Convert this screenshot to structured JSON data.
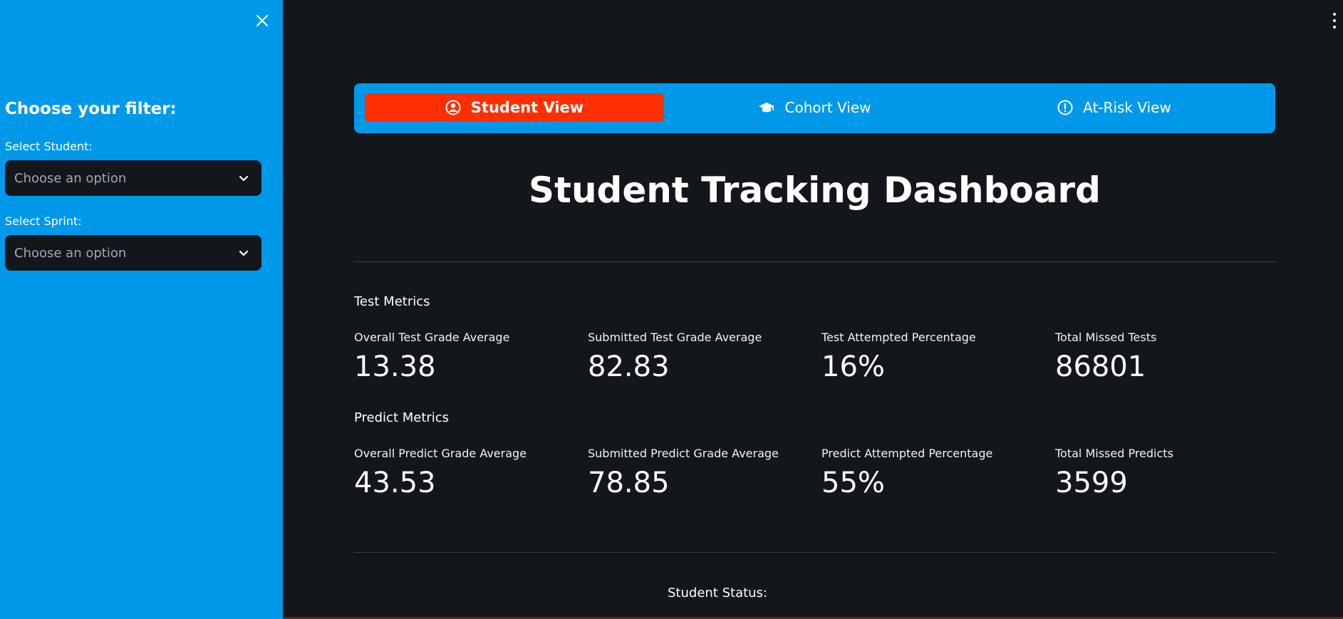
{
  "sidebar": {
    "title": "Choose your filter:",
    "student_label": "Select Student:",
    "student_placeholder": "Choose an option",
    "sprint_label": "Select Sprint:",
    "sprint_placeholder": "Choose an option"
  },
  "tabs": [
    {
      "label": "Student View",
      "icon": "user-circle-icon",
      "active": true
    },
    {
      "label": "Cohort View",
      "icon": "graduation-cap-icon",
      "active": false
    },
    {
      "label": "At-Risk View",
      "icon": "alert-circle-icon",
      "active": false
    }
  ],
  "main": {
    "title": "Student Tracking Dashboard",
    "test_section": "Test Metrics",
    "test_metrics": [
      {
        "label": "Overall Test Grade Average",
        "value": "13.38"
      },
      {
        "label": "Submitted Test Grade Average",
        "value": "82.83"
      },
      {
        "label": "Test Attempted Percentage",
        "value": "16%"
      },
      {
        "label": "Total Missed Tests",
        "value": "86801"
      }
    ],
    "predict_section": "Predict Metrics",
    "predict_metrics": [
      {
        "label": "Overall Predict Grade Average",
        "value": "43.53"
      },
      {
        "label": "Submitted Predict Grade Average",
        "value": "78.85"
      },
      {
        "label": "Predict Attempted Percentage",
        "value": "55%"
      },
      {
        "label": "Total Missed Predicts",
        "value": "3599"
      }
    ],
    "status_label": "Student Status:"
  },
  "colors": {
    "sidebar_bg": "#0099ea",
    "main_bg": "#13171c",
    "active_tab": "#ff2f00",
    "tabbar_bg": "#0099ea"
  }
}
